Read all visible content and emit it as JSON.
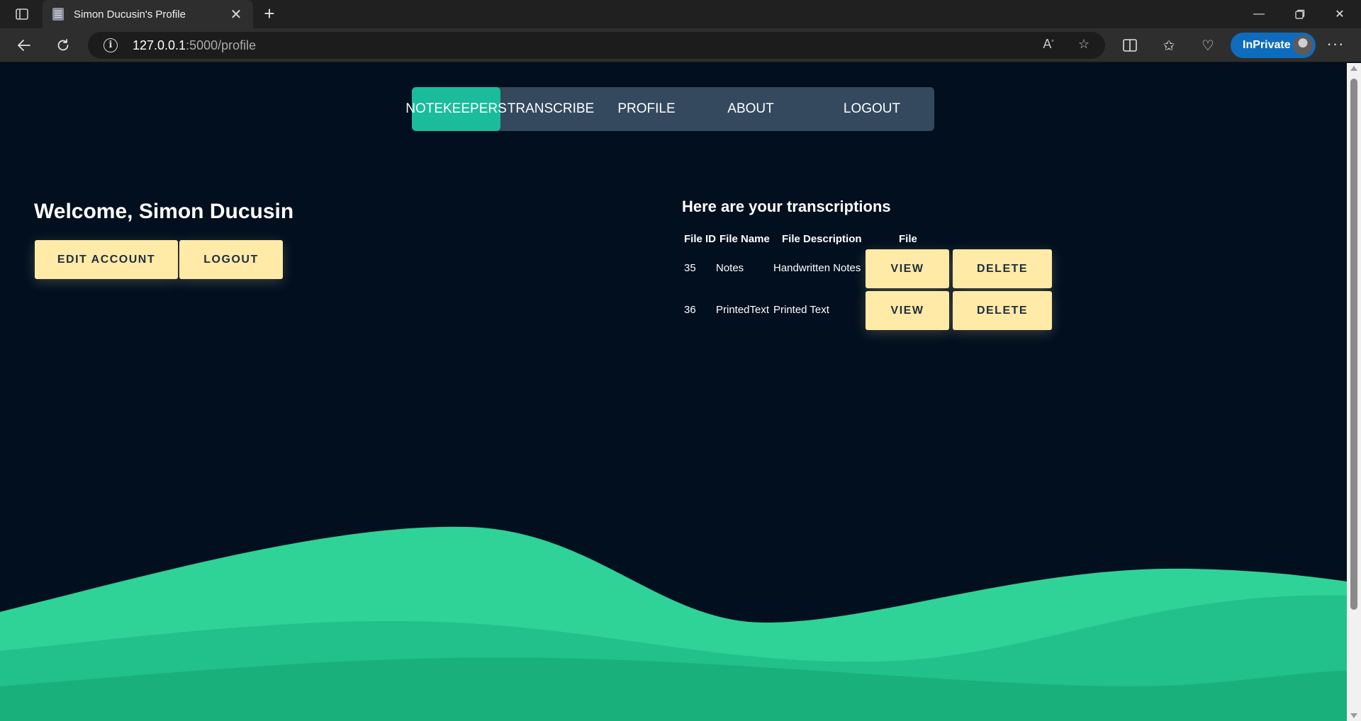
{
  "browser": {
    "tab_title": "Simon Ducusin's Profile",
    "url_host": "127.0.0.1",
    "url_rest": ":5000/profile",
    "inprivate_label": "InPrivate"
  },
  "nav": {
    "items": [
      "NOTEKEEPERS",
      "TRANSCRIBE",
      "PROFILE",
      "ABOUT",
      "LOGOUT"
    ],
    "active_index": 0
  },
  "profile": {
    "welcome": "Welcome, Simon Ducusin",
    "edit_account_label": "EDIT ACCOUNT",
    "logout_label": "LOGOUT"
  },
  "transcriptions": {
    "title": "Here are your transcriptions",
    "columns": [
      "File ID",
      "File Name",
      "File Description",
      "File"
    ],
    "rows": [
      {
        "id": "35",
        "name": "Notes",
        "description": "Handwritten Notes",
        "view": "VIEW",
        "delete": "DELETE"
      },
      {
        "id": "36",
        "name": "PrintedText",
        "description": "Printed Text",
        "view": "VIEW",
        "delete": "DELETE"
      }
    ]
  },
  "colors": {
    "background": "#010f1f",
    "nav_bg": "#34495e",
    "nav_active": "#1abc9c",
    "button_bg": "#ffeaa7",
    "wave_light": "#2fd297",
    "wave_mid": "#22c08a",
    "wave_dark": "#19b07c"
  }
}
